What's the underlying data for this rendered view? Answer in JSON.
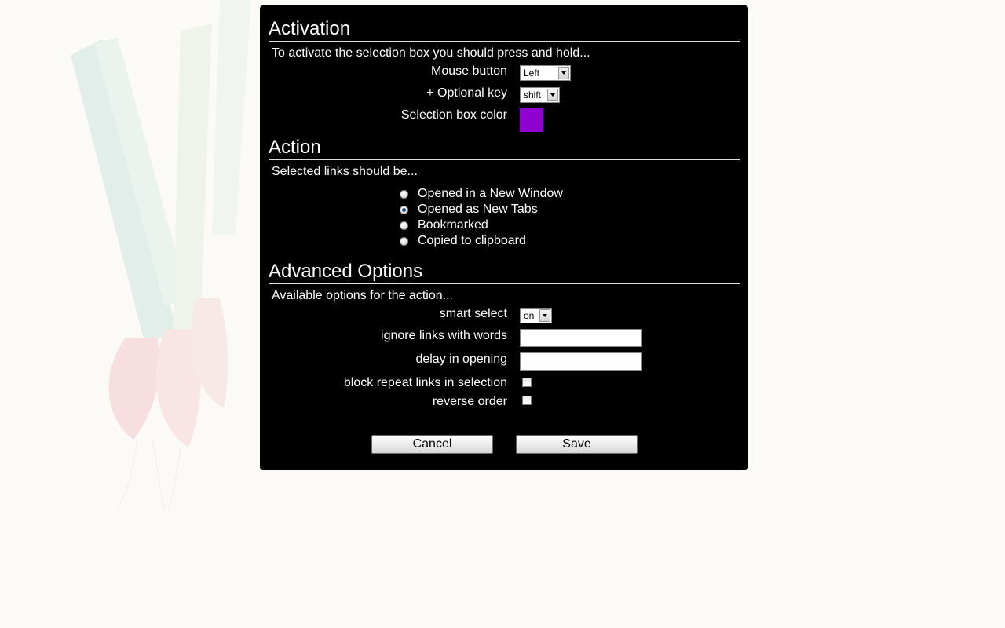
{
  "activation": {
    "title": "Activation",
    "intro": "To activate the selection box you should press and hold...",
    "mouse_button_label": "Mouse button",
    "mouse_button_value": "Left",
    "optional_key_label": "+ Optional key",
    "optional_key_value": "shift",
    "box_color_label": "Selection box color",
    "box_color": "#9000d0"
  },
  "action": {
    "title": "Action",
    "intro": "Selected links should be...",
    "options": [
      {
        "label": "Opened in a New Window",
        "checked": false
      },
      {
        "label": "Opened as New Tabs",
        "checked": true
      },
      {
        "label": "Bookmarked",
        "checked": false
      },
      {
        "label": "Copied to clipboard",
        "checked": false
      }
    ]
  },
  "advanced": {
    "title": "Advanced Options",
    "intro": "Available options for the action...",
    "smart_select_label": "smart select",
    "smart_select_value": "on",
    "ignore_words_label": "ignore links with words",
    "ignore_words_value": "",
    "delay_label": "delay in opening",
    "delay_value": "",
    "block_repeat_label": "block repeat links in selection",
    "block_repeat_checked": false,
    "reverse_order_label": "reverse order",
    "reverse_order_checked": false
  },
  "buttons": {
    "cancel": "Cancel",
    "save": "Save"
  }
}
